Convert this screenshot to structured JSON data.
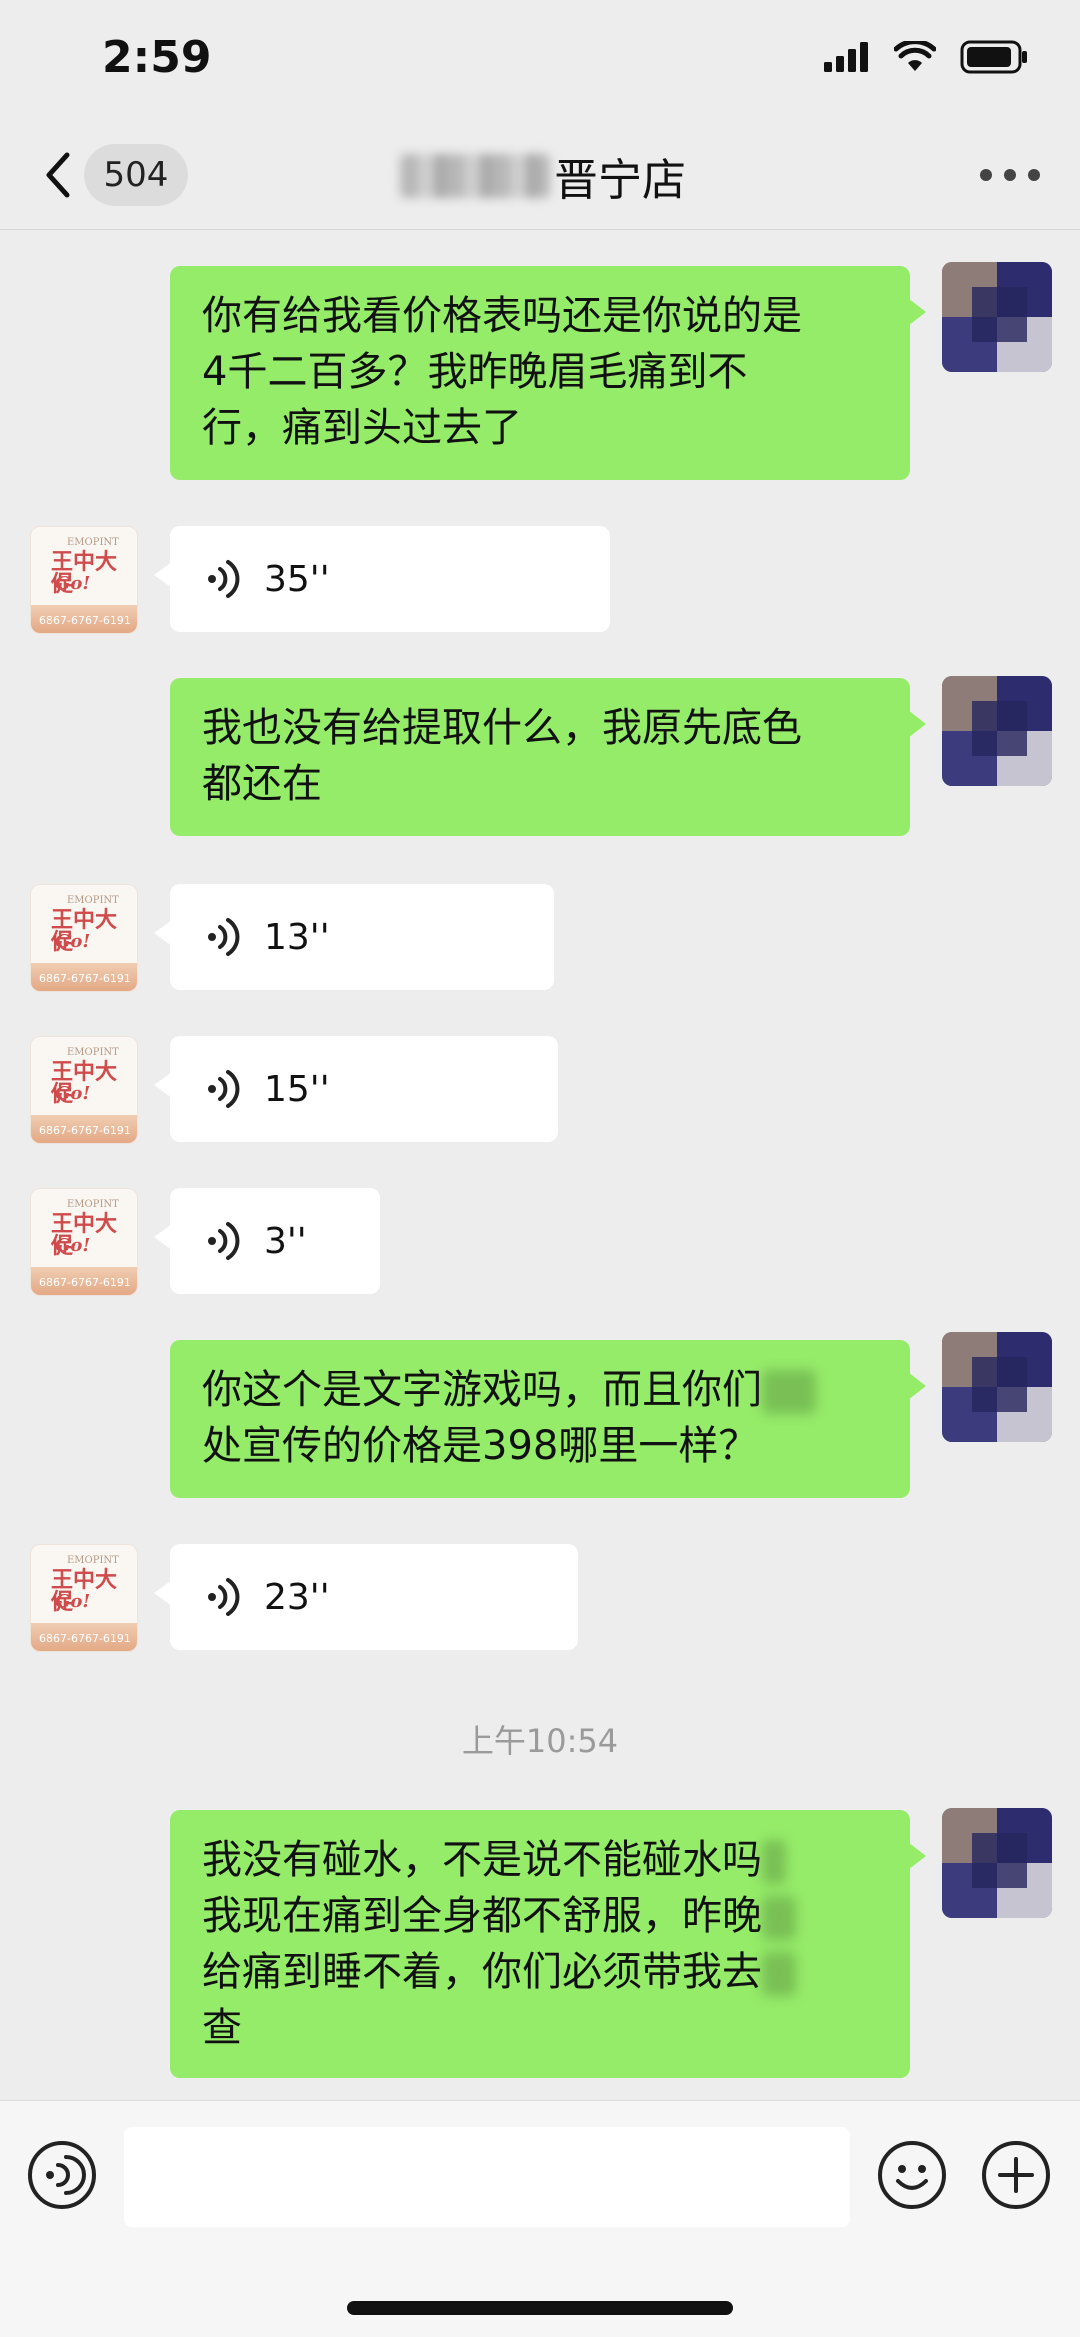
{
  "status_bar": {
    "time": "2:59"
  },
  "nav": {
    "unread_count": "504",
    "title_visible": "晋宁店"
  },
  "messages": [
    {
      "side": "right",
      "type": "text",
      "lines": [
        "你有给我看价格表吗还是你说的是",
        "4千二百多？我昨晚眉毛痛到不",
        "行，痛到头过去了"
      ]
    },
    {
      "side": "left",
      "type": "voice",
      "duration": "35''"
    },
    {
      "side": "right",
      "type": "text",
      "lines": [
        "我也没有给提取什么，我原先底色",
        "都还在"
      ]
    },
    {
      "side": "left",
      "type": "voice",
      "duration": "13''"
    },
    {
      "side": "left",
      "type": "voice",
      "duration": "15''"
    },
    {
      "side": "left",
      "type": "voice",
      "duration": "3''"
    },
    {
      "side": "right",
      "type": "text",
      "lines": [
        "你这个是文字游戏吗，而且你们",
        "处宣传的价格是398哪里一样？"
      ]
    },
    {
      "side": "left",
      "type": "voice",
      "duration": "23''"
    },
    {
      "side": "right",
      "type": "text",
      "lines": [
        "我没有碰水，不是说不能碰水吗",
        "我现在痛到全身都不舒服，昨晚",
        "给痛到睡不着，你们必须带我去",
        "查"
      ]
    }
  ],
  "time_divider": "上午10:54",
  "shop_avatar": {
    "small_text": "EMOPINT",
    "logo_line1": "王中大促",
    "logo_line2": "Go!",
    "number": "6867-6767-6191"
  },
  "input_bar": {
    "text_value": ""
  },
  "colors": {
    "bubble_green": "#95ec69",
    "bubble_white": "#ffffff",
    "background": "#ededed"
  },
  "icons": {
    "back": "chevron-left-icon",
    "more": "more-dots-icon",
    "voice": "voice-wave-icon",
    "emoji": "emoji-icon",
    "plus": "plus-icon"
  }
}
